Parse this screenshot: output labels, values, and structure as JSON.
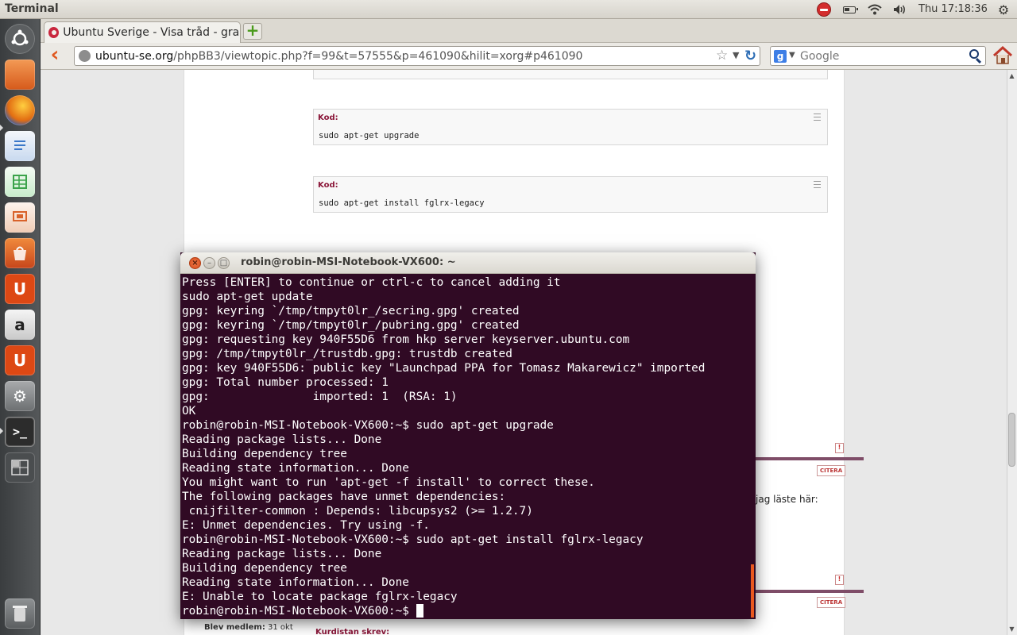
{
  "top_panel": {
    "app_title": "Terminal",
    "clock": "Thu  17:18:36",
    "icons": [
      "stop-icon",
      "battery-icon",
      "wifi-icon",
      "volume-icon",
      "session-gear-icon"
    ]
  },
  "launcher": {
    "items": [
      {
        "name": "dash-home-icon",
        "color": "#5c5f61"
      },
      {
        "name": "home-folder-icon",
        "color": "#e8702a"
      },
      {
        "name": "firefox-icon",
        "color": "#e26d12"
      },
      {
        "name": "writer-icon",
        "color": "#3a78c9"
      },
      {
        "name": "calc-icon",
        "color": "#3aa34a"
      },
      {
        "name": "impress-icon",
        "color": "#d9622a"
      },
      {
        "name": "software-center-icon",
        "color": "#d35a23"
      },
      {
        "name": "ubuntu-one-icon",
        "color": "#dd4814"
      },
      {
        "name": "amazon-icon",
        "color": "#cfcfcf"
      },
      {
        "name": "ubuntu-one-music-icon",
        "color": "#dd4814"
      },
      {
        "name": "system-settings-icon",
        "color": "#8a8c8e"
      },
      {
        "name": "terminal-icon",
        "color": "#2c2c2c"
      },
      {
        "name": "workspace-switcher-icon",
        "color": "#4a4d4f"
      },
      {
        "name": "trash-icon",
        "color": "#6b6e70"
      }
    ]
  },
  "browser": {
    "tab_title": "Ubuntu Sverige - Visa tråd - gra...",
    "new_tab_label": "+",
    "url_host": "ubuntu-se.org",
    "url_path": "/phpBB3/viewtopic.php?f=99&t=57555&p=461090&hilit=xorg#p461090",
    "search_placeholder": "Google"
  },
  "page": {
    "code_blocks": [
      {
        "label": "Kod:",
        "code": "sudo apt-get upgrade"
      },
      {
        "label": "Kod:",
        "code": "sudo apt-get install fglrx-legacy"
      }
    ],
    "quote_label": "CITERA",
    "report_label": "!",
    "post_text": "jag läste här:",
    "member_label": "Blev medlem:",
    "member_value": "31 okt",
    "quote_author": "Kurdistan skrev:"
  },
  "terminal": {
    "title": "robin@robin-MSI-Notebook-VX600: ~",
    "lines": [
      "Press [ENTER] to continue or ctrl-c to cancel adding it",
      "sudo apt-get update",
      "gpg: keyring `/tmp/tmpyt0lr_/secring.gpg' created",
      "gpg: keyring `/tmp/tmpyt0lr_/pubring.gpg' created",
      "gpg: requesting key 940F55D6 from hkp server keyserver.ubuntu.com",
      "gpg: /tmp/tmpyt0lr_/trustdb.gpg: trustdb created",
      "gpg: key 940F55D6: public key \"Launchpad PPA for Tomasz Makarewicz\" imported",
      "gpg: Total number processed: 1",
      "gpg:               imported: 1  (RSA: 1)",
      "OK",
      "robin@robin-MSI-Notebook-VX600:~$ sudo apt-get upgrade",
      "Reading package lists... Done",
      "Building dependency tree",
      "Reading state information... Done",
      "You might want to run 'apt-get -f install' to correct these.",
      "The following packages have unmet dependencies:",
      " cnijfilter-common : Depends: libcupsys2 (>= 1.2.7)",
      "E: Unmet dependencies. Try using -f.",
      "robin@robin-MSI-Notebook-VX600:~$ sudo apt-get install fglrx-legacy",
      "Reading package lists... Done",
      "Building dependency tree",
      "Reading state information... Done",
      "E: Unable to locate package fglrx-legacy"
    ],
    "prompt": "robin@robin-MSI-Notebook-VX600:~$ "
  }
}
